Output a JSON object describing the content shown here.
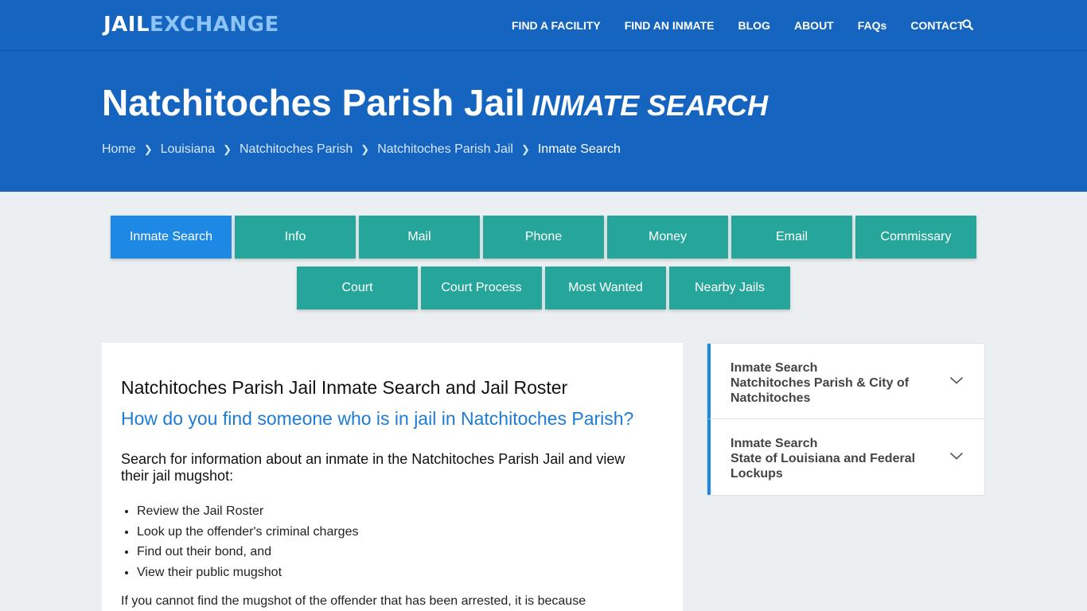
{
  "brand": {
    "part1": "JAIL",
    "part2": "EXCHANGE"
  },
  "nav": [
    {
      "label": "FIND A FACILITY"
    },
    {
      "label": "FIND AN INMATE"
    },
    {
      "label": "BLOG"
    },
    {
      "label": "ABOUT"
    },
    {
      "label": "FAQs"
    },
    {
      "label": "CONTACT"
    }
  ],
  "hero": {
    "title": "Natchitoches Parish Jail",
    "subtitle": "INMATE SEARCH",
    "breadcrumb": [
      "Home",
      "Louisiana",
      "Natchitoches Parish",
      "Natchitoches Parish Jail",
      "Inmate Search"
    ]
  },
  "tabs_row1": [
    "Inmate Search",
    "Info",
    "Mail",
    "Phone",
    "Money",
    "Email",
    "Commissary"
  ],
  "tabs_row2": [
    "Court",
    "Court Process",
    "Most Wanted",
    "Nearby Jails"
  ],
  "main": {
    "heading": "Natchitoches Parish Jail Inmate Search and Jail Roster",
    "question": "How do you find someone who is in jail in Natchitoches Parish?",
    "lead": "Search for information about an inmate in the Natchitoches Parish Jail and view their jail mugshot:",
    "list": [
      "Review the Jail Roster",
      "Look up the offender's criminal charges",
      "Find out their bond, and",
      "View their public mugshot"
    ],
    "more": "If you cannot find the mugshot of the offender that has been arrested, it is because"
  },
  "sidebar": [
    {
      "title": "Inmate Search",
      "line2": "Natchitoches Parish & City of Natchitoches"
    },
    {
      "title": "Inmate Search",
      "line2": "State of Louisiana and Federal Lockups"
    }
  ],
  "colors": {
    "header": "#1565c0",
    "tab": "#26a69a",
    "tab_active": "#1e88e5",
    "question": "#1e7bd6"
  }
}
